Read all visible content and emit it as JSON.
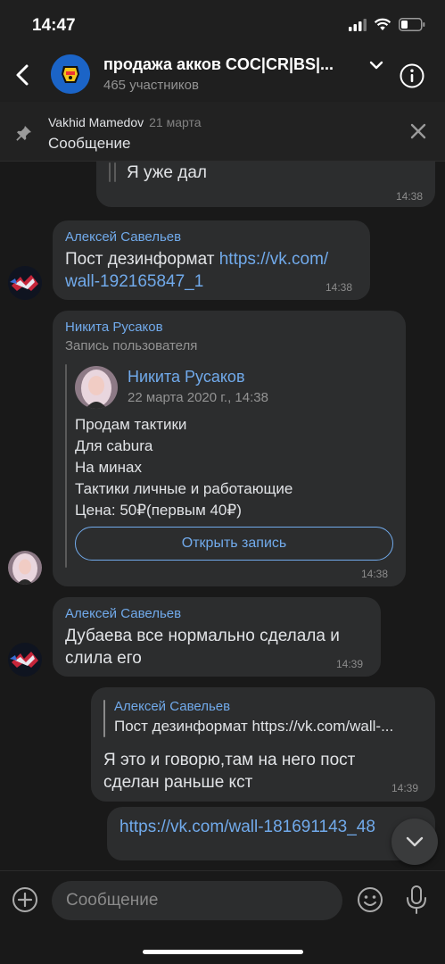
{
  "status_bar": {
    "time": "14:47"
  },
  "header": {
    "title": "продажа акков COC|CR|BS|...",
    "subtitle": "465 участников"
  },
  "pinned": {
    "author": "Vakhid Mamedov",
    "date": "21 марта",
    "text": "Сообщение"
  },
  "messages": {
    "m0": {
      "text": "Я уже дал",
      "time": "14:38"
    },
    "m1": {
      "author": "Алексей Савельев",
      "text_plain": "Пост дезинформат ",
      "link_part1": "https://vk.com/",
      "link_part2": "wall-192165847_1",
      "time": "14:38"
    },
    "m2": {
      "author": "Никита Русаков",
      "subtitle": "Запись пользователя",
      "post_author": "Никита Русаков",
      "post_date": "22 марта 2020 г., 14:38",
      "post_lines": [
        "Продам тактики",
        "Для cabura",
        "На минах",
        "Тактики личные и работающие",
        "Цена: 50₽(первым 40₽)"
      ],
      "open_button": "Открыть запись",
      "time": "14:38"
    },
    "m3": {
      "author": "Алексей Савельев",
      "lines": [
        "Дубаева все нормально сделала и",
        "слила его"
      ],
      "time": "14:39"
    },
    "m4": {
      "reply_author": "Алексей Савельев",
      "reply_text": "Пост дезинформат https://vk.com/wall-...",
      "lines": [
        "Я это и говорю,там на него пост",
        "сделан раньше кст"
      ],
      "time": "14:39"
    },
    "m5": {
      "link": "https://vk.com/wall-181691143_48"
    }
  },
  "composer": {
    "placeholder": "Сообщение"
  },
  "colors": {
    "accent": "#71aaeb",
    "bubble": "#2c2d2e",
    "background": "#191919"
  }
}
